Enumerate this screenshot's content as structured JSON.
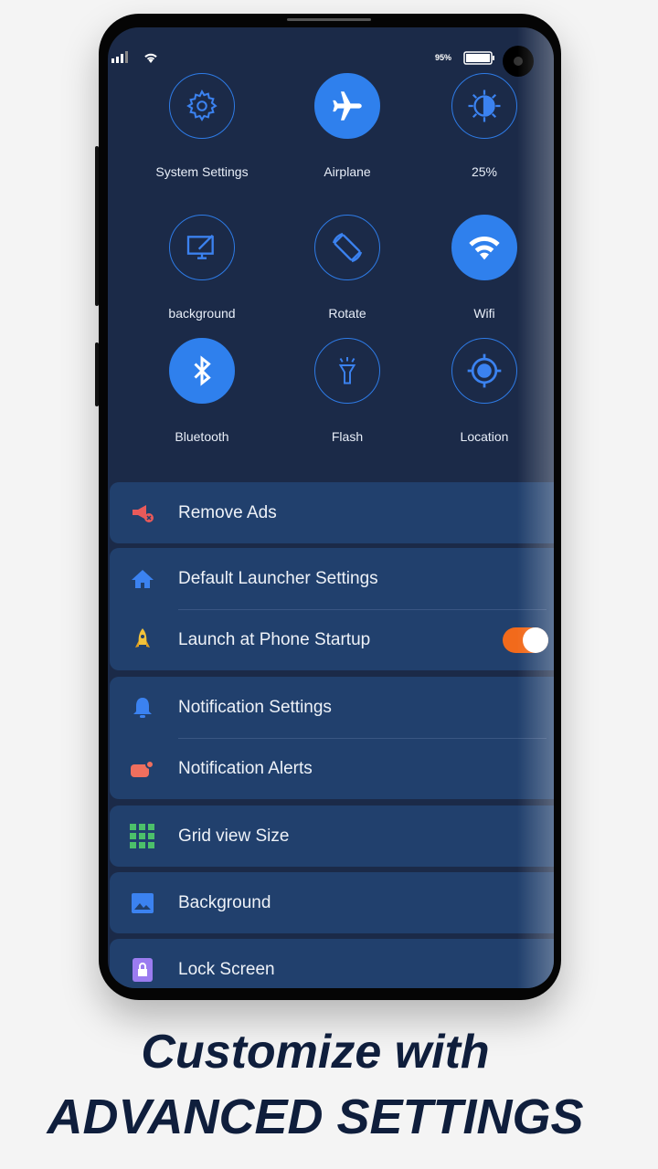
{
  "status_bar": {
    "battery": "95%"
  },
  "quick_tiles": [
    {
      "label": "System Settings",
      "icon": "gear-icon",
      "active": false
    },
    {
      "label": "Airplane",
      "icon": "airplane-icon",
      "active": true
    },
    {
      "label": "25%",
      "icon": "brightness-icon",
      "active": false
    },
    {
      "label": "background",
      "icon": "monitor-edit-icon",
      "active": false
    },
    {
      "label": "Rotate",
      "icon": "rotate-icon",
      "active": false
    },
    {
      "label": "Wifi",
      "icon": "wifi-icon",
      "active": true
    },
    {
      "label": "Bluetooth",
      "icon": "bluetooth-icon",
      "active": true
    },
    {
      "label": "Flash",
      "icon": "flashlight-icon",
      "active": false
    },
    {
      "label": "Location",
      "icon": "location-icon",
      "active": false
    }
  ],
  "settings": {
    "remove_ads": "Remove Ads",
    "default_launcher": "Default Launcher Settings",
    "launch_startup": "Launch at Phone Startup",
    "launch_startup_on": true,
    "notification_settings": "Notification Settings",
    "notification_alerts": "Notification Alerts",
    "grid_size": "Grid view Size",
    "background": "Background",
    "lock_screen": "Lock Screen"
  },
  "caption": {
    "line1": "Customize with",
    "line2": "ADVANCED SETTINGS"
  },
  "colors": {
    "accent": "#2f80ed",
    "toggle": "#f26a1b",
    "screen": "#1b2a48",
    "card": "#21406d"
  }
}
